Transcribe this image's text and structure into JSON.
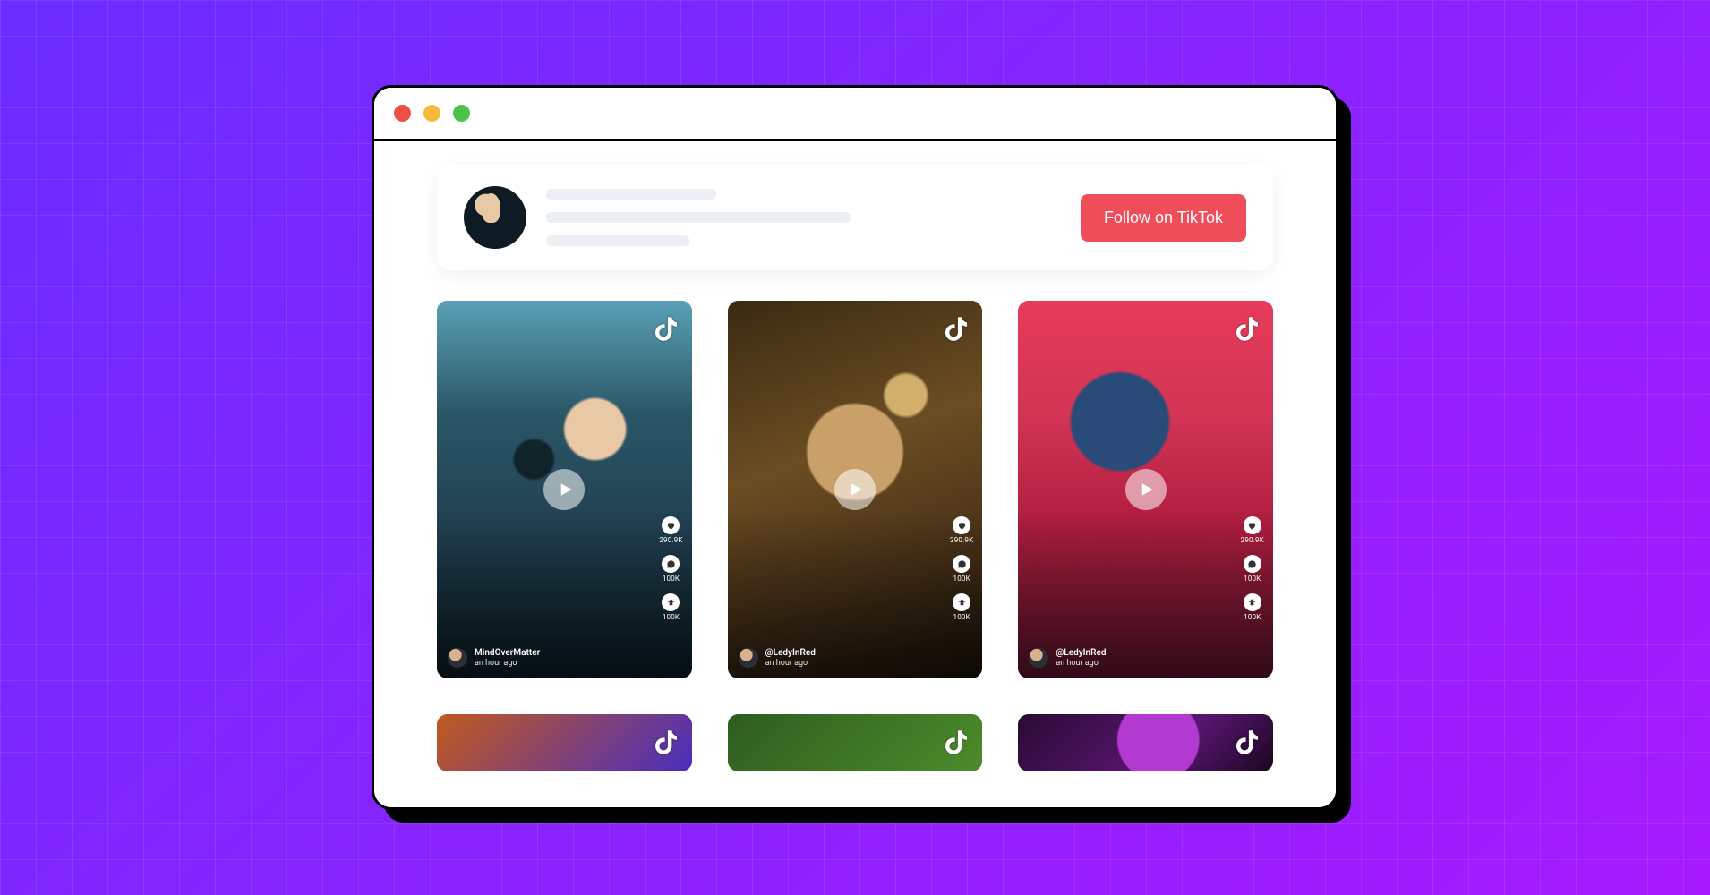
{
  "header": {
    "follow_label": "Follow on TikTok"
  },
  "videos": [
    {
      "username": "MindOverMatter",
      "time": "an hour ago",
      "likes": "290.9K",
      "comments": "100K",
      "shares": "100K"
    },
    {
      "username": "@LedyInRed",
      "time": "an hour ago",
      "likes": "290.9K",
      "comments": "100K",
      "shares": "100K"
    },
    {
      "username": "@LedyInRed",
      "time": "an hour ago",
      "likes": "290.9K",
      "comments": "100K",
      "shares": "100K"
    }
  ]
}
